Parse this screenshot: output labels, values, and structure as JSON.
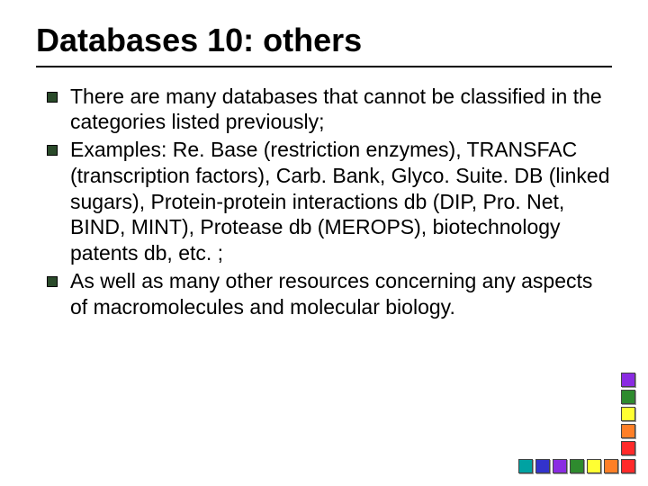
{
  "title": "Databases 10: others",
  "bullets": [
    "There are many databases that cannot be classified in the categories listed previously;",
    "Examples: Re. Base (restriction enzymes), TRANSFAC (transcription factors), Carb. Bank, Glyco. Suite. DB (linked sugars), Protein-protein interactions db (DIP, Pro. Net, BIND, MINT), Protease db (MEROPS), biotechnology patents db, etc. ;",
    "As well as many other resources concerning any aspects of macromolecules and molecular biology."
  ],
  "swatch_column": [
    "#8a2be2",
    "#2e8b2e",
    "#ffff33",
    "#ff7f27",
    "#ff2a2a"
  ],
  "swatch_row": [
    "#00a2a2",
    "#3333cc",
    "#8a2be2",
    "#2e8b2e",
    "#ffff33",
    "#ff7f27",
    "#ff2a2a"
  ]
}
